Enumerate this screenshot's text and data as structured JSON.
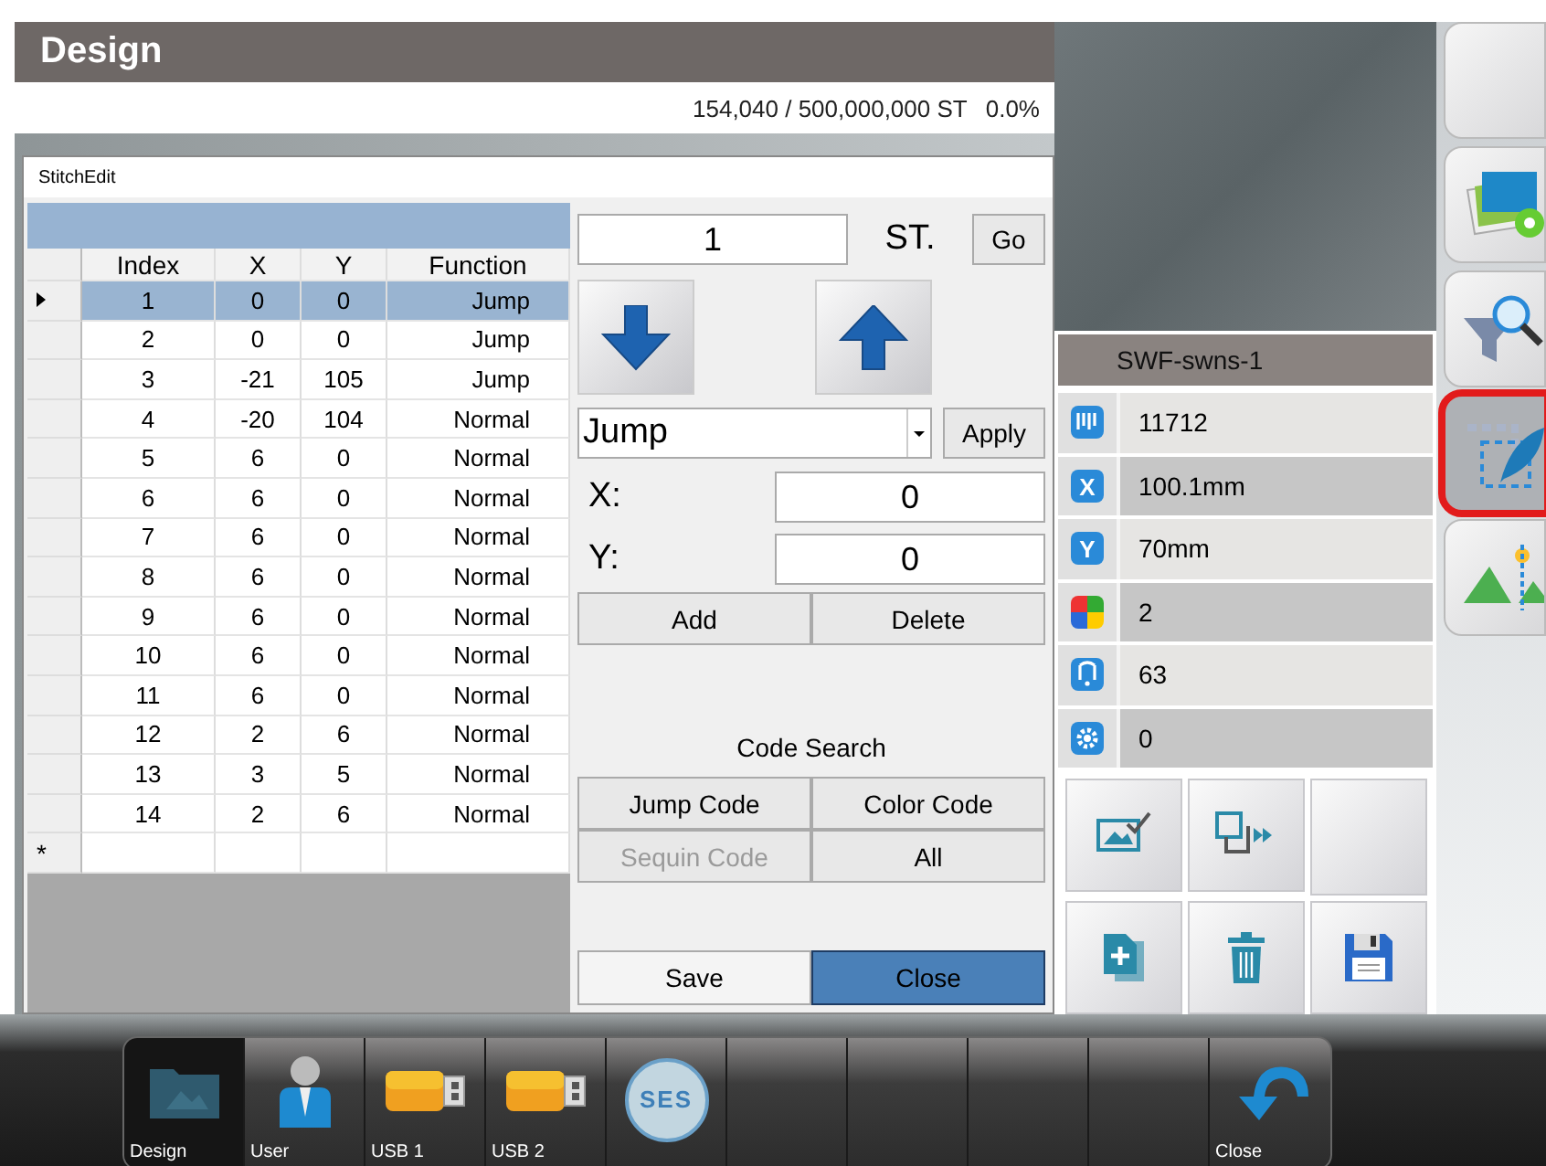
{
  "title_bar": {
    "title": "Design"
  },
  "status": {
    "stitches": "154,040 / 500,000,000 ST",
    "percent": "0.0%"
  },
  "dialog": {
    "title": "StitchEdit",
    "table": {
      "columns": [
        "Index",
        "X",
        "Y",
        "Function"
      ],
      "rows": [
        {
          "cells": [
            "1",
            "0",
            "0",
            "Jump"
          ],
          "selected": true
        },
        {
          "cells": [
            "2",
            "0",
            "0",
            "Jump"
          ],
          "selected": false
        },
        {
          "cells": [
            "3",
            "-21",
            "105",
            "Jump"
          ],
          "selected": false
        },
        {
          "cells": [
            "4",
            "-20",
            "104",
            "Normal"
          ],
          "selected": false
        },
        {
          "cells": [
            "5",
            "6",
            "0",
            "Normal"
          ],
          "selected": false
        },
        {
          "cells": [
            "6",
            "6",
            "0",
            "Normal"
          ],
          "selected": false
        },
        {
          "cells": [
            "7",
            "6",
            "0",
            "Normal"
          ],
          "selected": false
        },
        {
          "cells": [
            "8",
            "6",
            "0",
            "Normal"
          ],
          "selected": false
        },
        {
          "cells": [
            "9",
            "6",
            "0",
            "Normal"
          ],
          "selected": false
        },
        {
          "cells": [
            "10",
            "6",
            "0",
            "Normal"
          ],
          "selected": false
        },
        {
          "cells": [
            "11",
            "6",
            "0",
            "Normal"
          ],
          "selected": false
        },
        {
          "cells": [
            "12",
            "2",
            "6",
            "Normal"
          ],
          "selected": false
        },
        {
          "cells": [
            "13",
            "3",
            "5",
            "Normal"
          ],
          "selected": false
        },
        {
          "cells": [
            "14",
            "2",
            "6",
            "Normal"
          ],
          "selected": false
        }
      ],
      "new_row_marker": "*"
    },
    "stitch_field": "1",
    "st_label": "ST.",
    "go": "Go",
    "function_select": "Jump",
    "apply": "Apply",
    "x_label": "X:",
    "x_value": "0",
    "y_label": "Y:",
    "y_value": "0",
    "add": "Add",
    "delete": "Delete",
    "code_search_label": "Code Search",
    "code_buttons": [
      {
        "label": "Jump Code",
        "disabled": false
      },
      {
        "label": "Color Code",
        "disabled": false
      },
      {
        "label": "Sequin Code",
        "disabled": true
      },
      {
        "label": "All",
        "disabled": false
      }
    ],
    "footer_buttons": [
      {
        "label": "Save",
        "selected": false
      },
      {
        "label": "Close",
        "selected": true
      }
    ]
  },
  "design_info": {
    "name": "SWF-swns-1",
    "rows": [
      {
        "kind": "stitches",
        "value": "11712"
      },
      {
        "kind": "width",
        "badge": "X",
        "value": "100.1mm"
      },
      {
        "kind": "height",
        "badge": "Y",
        "value": "70mm"
      },
      {
        "kind": "colors",
        "value": "2"
      },
      {
        "kind": "jumps",
        "value": "63"
      },
      {
        "kind": "settings",
        "value": "0"
      }
    ]
  },
  "action_buttons": [
    {
      "kind": "image-check"
    },
    {
      "kind": "move"
    },
    {
      "kind": "empty"
    },
    {
      "kind": "add"
    },
    {
      "kind": "delete"
    },
    {
      "kind": "save"
    }
  ],
  "side_buttons": [
    {
      "kind": "blank",
      "selected": false
    },
    {
      "kind": "photos",
      "selected": false
    },
    {
      "kind": "filter-search",
      "selected": false
    },
    {
      "kind": "edit-area",
      "selected": true
    },
    {
      "kind": "mirror",
      "selected": false
    }
  ],
  "taskbar": [
    {
      "kind": "design",
      "label": "Design",
      "selected": true
    },
    {
      "kind": "user",
      "label": "User",
      "selected": false
    },
    {
      "kind": "usb",
      "label": "USB 1",
      "selected": false
    },
    {
      "kind": "usb",
      "label": "USB 2",
      "selected": false
    },
    {
      "kind": "logo",
      "logo_text": "SES",
      "selected": false
    },
    {
      "kind": "empty",
      "selected": false
    },
    {
      "kind": "empty",
      "selected": false
    },
    {
      "kind": "empty",
      "selected": false
    },
    {
      "kind": "empty",
      "selected": false
    },
    {
      "kind": "close",
      "label": "Close",
      "selected": false
    }
  ]
}
